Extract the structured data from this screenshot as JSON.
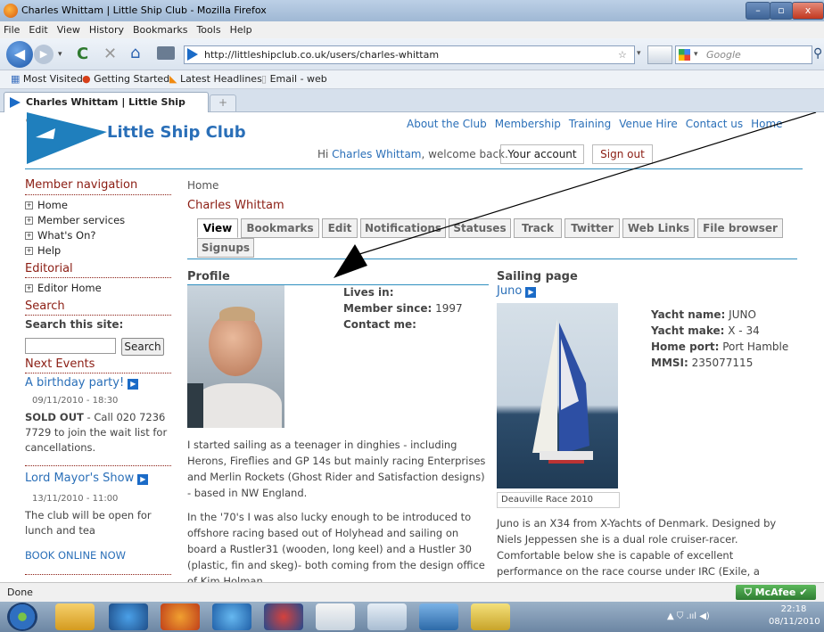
{
  "window": {
    "title": "Charles Whittam | Little Ship Club - Mozilla Firefox"
  },
  "menu": [
    "File",
    "Edit",
    "View",
    "History",
    "Bookmarks",
    "Tools",
    "Help"
  ],
  "toolbar": {
    "url": "http://littleshipclub.co.uk/users/charles-whittam",
    "search_placeholder": "Google"
  },
  "bookmarks": [
    "Most Visited",
    "Getting Started",
    "Latest Headlines",
    "Email - web"
  ],
  "tabs": {
    "active": "Charles Whittam | Little Ship Club",
    "new": "+"
  },
  "site": {
    "logo": "Little Ship Club",
    "topnav": [
      "About the Club",
      "Membership",
      "Training",
      "Venue Hire",
      "Contact us",
      "Home"
    ],
    "welcome_prefix": "Hi ",
    "welcome_name": "Charles Whittam",
    "welcome_suffix": ", welcome back.",
    "your_account": "Your account",
    "sign_out": "Sign out"
  },
  "sidebar": {
    "member_nav_title": "Member navigation",
    "member_items": [
      "Home",
      "Member services",
      "What's On?",
      "Help"
    ],
    "editorial_title": "Editorial",
    "editor_items": [
      "Editor Home"
    ],
    "search_title": "Search",
    "search_label": "Search this site:",
    "search_button": "Search",
    "events_title": "Next Events",
    "events": [
      {
        "title": "A birthday party!",
        "date": "09/11/2010 - 18:30",
        "bold": "SOLD OUT",
        "text": " - Call 020 7236 7729 to  join the wait list for cancellations."
      },
      {
        "title": "Lord Mayor's Show",
        "date": "13/11/2010 - 11:00",
        "text": " The club will be open for lunch and tea"
      }
    ],
    "book_online": "BOOK ONLINE NOW"
  },
  "main": {
    "breadcrumb": "Home",
    "page_title": "Charles Whittam",
    "tabs": [
      "View",
      "Bookmarks",
      "Edit",
      "Notifications",
      "Statuses",
      "Track",
      "Twitter",
      "Web Links",
      "File browser",
      "Signups"
    ],
    "profile_heading": "Profile",
    "lives_in_label": "Lives in:",
    "member_since_label": "Member since:",
    "member_since_value": " 1997",
    "contact_label": "Contact me:",
    "bio_1": "I started sailing as a teenager in dinghies - including Herons, Fireflies and GP 14s but mainly racing Enterprises and Merlin Rockets (Ghost Rider and Satisfaction designs) - based in NW England.",
    "bio_2": "In the '70's I was also lucky enough to be introduced to offshore racing based out of Holyhead and sailing on board a Rustler31 (wooden, long keel) and a Hustler 30 (plastic, fin and skeg)- both coming from the design office of Kim Holman."
  },
  "sailing": {
    "heading": "Sailing page",
    "boat_link": "Juno",
    "caption": "Deauville Race 2010",
    "yacht_name_label": "Yacht name:",
    "yacht_name": " JUNO",
    "yacht_make_label": "Yacht make:",
    "yacht_make": " X - 34",
    "home_port_label": "Home port:",
    "home_port": " Port Hamble",
    "mmsi_label": "MMSI:",
    "mmsi": " 235077115",
    "description": "Juno is an X34 from X-Yachts of Denmark. Designed by Niels Jeppessen she is a dual role cruiser-racer. Comfortable below she is capable of excellent performance on the race course under IRC (Exile, a"
  },
  "status": {
    "text": "Done",
    "mcafee": "McAfee"
  },
  "clock": {
    "time": "22:18",
    "date": "08/11/2010"
  }
}
